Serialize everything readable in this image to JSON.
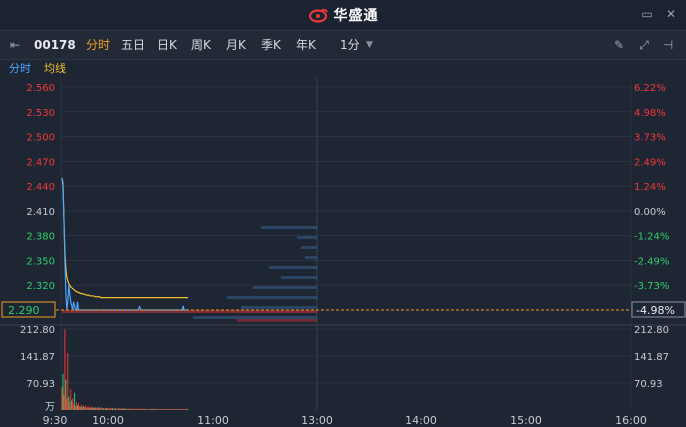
{
  "app": {
    "brand": "华盛通"
  },
  "toolbar": {
    "code": "00178",
    "tabs": [
      "分时",
      "五日",
      "日K",
      "周K",
      "月K",
      "季K",
      "年K"
    ],
    "active_tab": "分时",
    "interval": "1分",
    "icons": [
      "pencil-icon",
      "fullscreen-icon",
      "pin-icon"
    ]
  },
  "subtabs": {
    "time": "分时",
    "avg": "均线"
  },
  "colors": {
    "up": "#f03a3a",
    "down": "#2ecf6b",
    "price": "#4aa6ff",
    "avg": "#f0c030",
    "grid": "#2b3443",
    "ref": "#ffffff"
  },
  "chart_data": {
    "type": "line",
    "prev_close": 2.41,
    "y_ticks_left": [
      "2.560",
      "2.530",
      "2.500",
      "2.470",
      "2.440",
      "2.410",
      "2.380",
      "2.350",
      "2.320",
      "2.290"
    ],
    "y_ticks_right": [
      "6.22%",
      "4.98%",
      "3.73%",
      "2.49%",
      "1.24%",
      "0.00%",
      "-1.24%",
      "-2.49%",
      "-3.73%",
      "-4.98%"
    ],
    "current_price": "2.290",
    "current_pct": "-4.98%",
    "x_ticks": [
      "9:30",
      "10:00",
      "11:00",
      "13:00",
      "14:00",
      "15:00",
      "16:00"
    ],
    "volume_ticks": [
      "212.80",
      "141.87",
      "70.93"
    ],
    "volume_unit": "万",
    "price_series": [
      2.45,
      2.445,
      2.4,
      2.35,
      2.31,
      2.29,
      2.3,
      2.32,
      2.31,
      2.3,
      2.295,
      2.29,
      2.3,
      2.295,
      2.29,
      2.29,
      2.3,
      2.29,
      2.29,
      2.29,
      2.29,
      2.29,
      2.29,
      2.29,
      2.29,
      2.29,
      2.29,
      2.29,
      2.29,
      2.29,
      2.29,
      2.29,
      2.29,
      2.29,
      2.29,
      2.29,
      2.29,
      2.29,
      2.29,
      2.29,
      2.29,
      2.29,
      2.29,
      2.29,
      2.29,
      2.29,
      2.29,
      2.29,
      2.29,
      2.29,
      2.29,
      2.29,
      2.29,
      2.29,
      2.29,
      2.29,
      2.29,
      2.29,
      2.29,
      2.29,
      2.29,
      2.29,
      2.29,
      2.29,
      2.29,
      2.29,
      2.29,
      2.29,
      2.29,
      2.29,
      2.29,
      2.29,
      2.29,
      2.29,
      2.29,
      2.29,
      2.29,
      2.29,
      2.29,
      2.29,
      2.295,
      2.29,
      2.29,
      2.29,
      2.29,
      2.29,
      2.29,
      2.29,
      2.29,
      2.29,
      2.29,
      2.29,
      2.29,
      2.29,
      2.29,
      2.29,
      2.29,
      2.29,
      2.29,
      2.29,
      2.29,
      2.29,
      2.29,
      2.29,
      2.29,
      2.29,
      2.29,
      2.29,
      2.29,
      2.29,
      2.29,
      2.29,
      2.29,
      2.29,
      2.29,
      2.29,
      2.29,
      2.29,
      2.29,
      2.29,
      2.29,
      2.29,
      2.29,
      2.29,
      2.29,
      2.295,
      2.29,
      2.29,
      2.29,
      2.29,
      2.29
    ],
    "avg_series": [
      2.45,
      2.44,
      2.4,
      2.36,
      2.34,
      2.33,
      2.325,
      2.322,
      2.32,
      2.318,
      2.317,
      2.316,
      2.315,
      2.314,
      2.313,
      2.312,
      2.312,
      2.311,
      2.311,
      2.31,
      2.31,
      2.31,
      2.309,
      2.309,
      2.309,
      2.308,
      2.308,
      2.308,
      2.308,
      2.307,
      2.307,
      2.307,
      2.307,
      2.307,
      2.306,
      2.306,
      2.306,
      2.306,
      2.306,
      2.306,
      2.305,
      2.305,
      2.305,
      2.305,
      2.305,
      2.305,
      2.305,
      2.305,
      2.305,
      2.305,
      2.305,
      2.305,
      2.305,
      2.305,
      2.305,
      2.305,
      2.305,
      2.305,
      2.305,
      2.305,
      2.305,
      2.305,
      2.305,
      2.305,
      2.305,
      2.305,
      2.305,
      2.305,
      2.305,
      2.305,
      2.305,
      2.305,
      2.305,
      2.305,
      2.305,
      2.305,
      2.305,
      2.305,
      2.305,
      2.305,
      2.305,
      2.305,
      2.305,
      2.305,
      2.305,
      2.305,
      2.305,
      2.305,
      2.305,
      2.305,
      2.305,
      2.305,
      2.305,
      2.305,
      2.305,
      2.305,
      2.305,
      2.305,
      2.305,
      2.305,
      2.305,
      2.305,
      2.305,
      2.305,
      2.305,
      2.305,
      2.305,
      2.305,
      2.305,
      2.305,
      2.305,
      2.305,
      2.305,
      2.305,
      2.305,
      2.305,
      2.305,
      2.305,
      2.305,
      2.305,
      2.305,
      2.305,
      2.305,
      2.305,
      2.305,
      2.305,
      2.305,
      2.305,
      2.305,
      2.305,
      2.305
    ],
    "volume_series": [
      60,
      95,
      40,
      212,
      80,
      30,
      150,
      35,
      20,
      55,
      25,
      30,
      15,
      45,
      10,
      20,
      12,
      18,
      10,
      8,
      14,
      9,
      10,
      8,
      12,
      6,
      8,
      10,
      5,
      7,
      9,
      6,
      8,
      5,
      7,
      6,
      5,
      8,
      6,
      5,
      7,
      4,
      6,
      5,
      4,
      6,
      5,
      4,
      5,
      3,
      6,
      4,
      5,
      4,
      3,
      5,
      4,
      3,
      4,
      5,
      3,
      4,
      3,
      5,
      4,
      3,
      4,
      3,
      2,
      4,
      3,
      4,
      2,
      3,
      4,
      3,
      2,
      3,
      4,
      2,
      3,
      2,
      3,
      2,
      4,
      3,
      2,
      3,
      2,
      3,
      2,
      3,
      2,
      4,
      2,
      3,
      2,
      3,
      2,
      3,
      2,
      2,
      3,
      2,
      3,
      2,
      2,
      3,
      2,
      2,
      3,
      2,
      2,
      3,
      2,
      2,
      3,
      2,
      2,
      3,
      2,
      2,
      3,
      2,
      2,
      3,
      2,
      2,
      3,
      2,
      2
    ],
    "volume_colors": "mixed",
    "order_book_bars": [
      0.28,
      0.1,
      0.08,
      0.06,
      0.24,
      0.18,
      0.32,
      0.45,
      0.38,
      0.62
    ]
  }
}
